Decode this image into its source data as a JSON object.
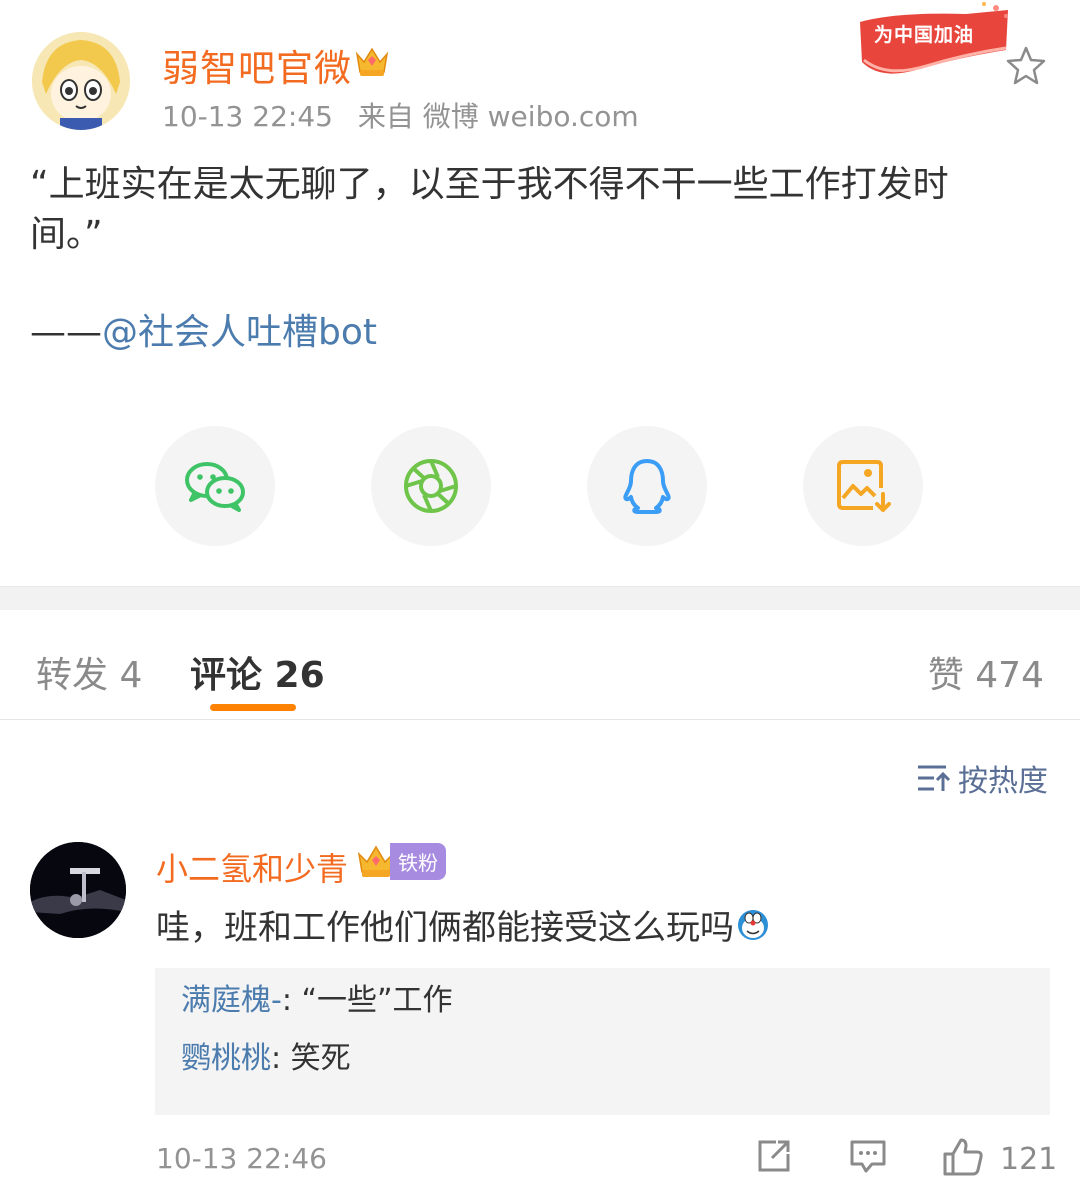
{
  "post": {
    "author_name": "弱智吧官微",
    "time": "10-13 22:45",
    "source": "来自 微博 weibo.com",
    "campaign_badge": "为中国加油",
    "text_line1": "“上班实在是太无聊了，以至于我不得不干一些工作打发时",
    "text_line2": "间。”",
    "sign_prefix": "——",
    "sign_mention": "@社会人吐槽bot"
  },
  "share": {
    "icons": [
      "wechat-icon",
      "moments-icon",
      "qq-icon",
      "save-image-icon"
    ],
    "colors": {
      "wechat": "#3ec466",
      "moments": "#6fc44a",
      "qq": "#3b9df5",
      "save": "#f5a623"
    }
  },
  "tabs": {
    "forward": "转发 4",
    "comment": "评论 26",
    "like": "赞 474"
  },
  "sort": {
    "label": "按热度"
  },
  "comment": {
    "name": "小二氢和少青",
    "fan_badge": "铁粉",
    "text": "哇，班和工作他们俩都能接受这么玩吗",
    "time": "10-13 22:46",
    "like_count": "121",
    "replies": [
      {
        "name": "满庭槐-",
        "text": ": “一些”工作"
      },
      {
        "name": "鹦桃桃",
        "text": ": 笑死"
      }
    ]
  },
  "colors": {
    "accent_orange": "#f36b21",
    "tab_underline": "#ff8200",
    "link_blue": "#4c7cae"
  }
}
